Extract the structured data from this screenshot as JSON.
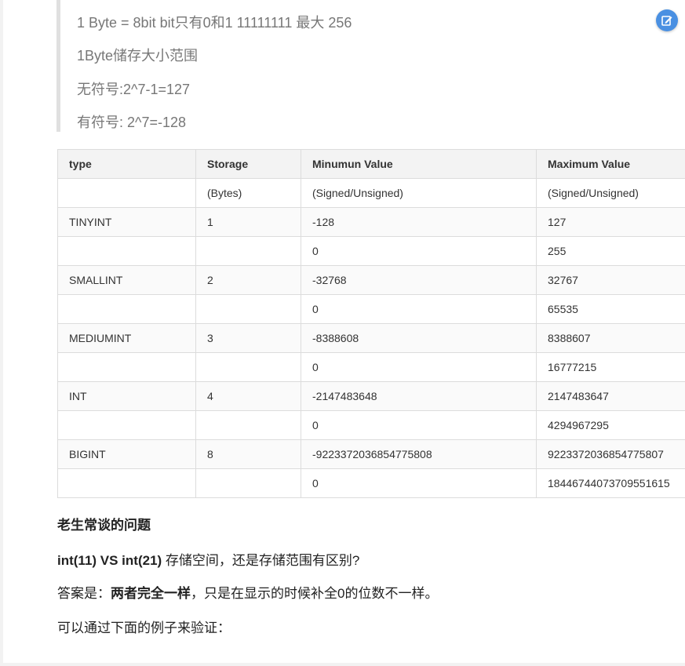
{
  "quote": {
    "line1": "1 Byte = 8bit bit只有0和1 11111111 最大 256",
    "line2": "1Byte储存大小范围",
    "line3": "无符号:2^7-1=127",
    "line4": "有符号: 2^7=-128"
  },
  "table": {
    "headers": [
      "type",
      "Storage",
      "Minumun Value",
      "Maximum Value"
    ],
    "rows": [
      [
        "",
        "(Bytes)",
        "(Signed/Unsigned)",
        "(Signed/Unsigned)"
      ],
      [
        "TINYINT",
        "1",
        "-128",
        "127"
      ],
      [
        "",
        "",
        "0",
        "255"
      ],
      [
        "SMALLINT",
        "2",
        "-32768",
        "32767"
      ],
      [
        "",
        "",
        "0",
        "65535"
      ],
      [
        "MEDIUMINT",
        "3",
        "-8388608",
        "8388607"
      ],
      [
        "",
        "",
        "0",
        "16777215"
      ],
      [
        "INT",
        "4",
        "-2147483648",
        "2147483647"
      ],
      [
        "",
        "",
        "0",
        "4294967295"
      ],
      [
        "BIGINT",
        "8",
        "-9223372036854775808",
        "9223372036854775807"
      ],
      [
        "",
        "",
        "0",
        "18446744073709551615"
      ]
    ]
  },
  "section": {
    "heading": "老生常谈的问题",
    "question_bold": "int(11) VS int(21)",
    "question_rest": " 存储空间，还是存储范围有区别?",
    "answer_prefix": "答案是：",
    "answer_bold": "两者完全一样",
    "answer_rest": "，只是在显示的时候补全0的位数不一样。",
    "verify": "可以通过下面的例子来验证："
  },
  "floating_button": {
    "icon": "edit-icon",
    "color": "#4a90e2"
  }
}
